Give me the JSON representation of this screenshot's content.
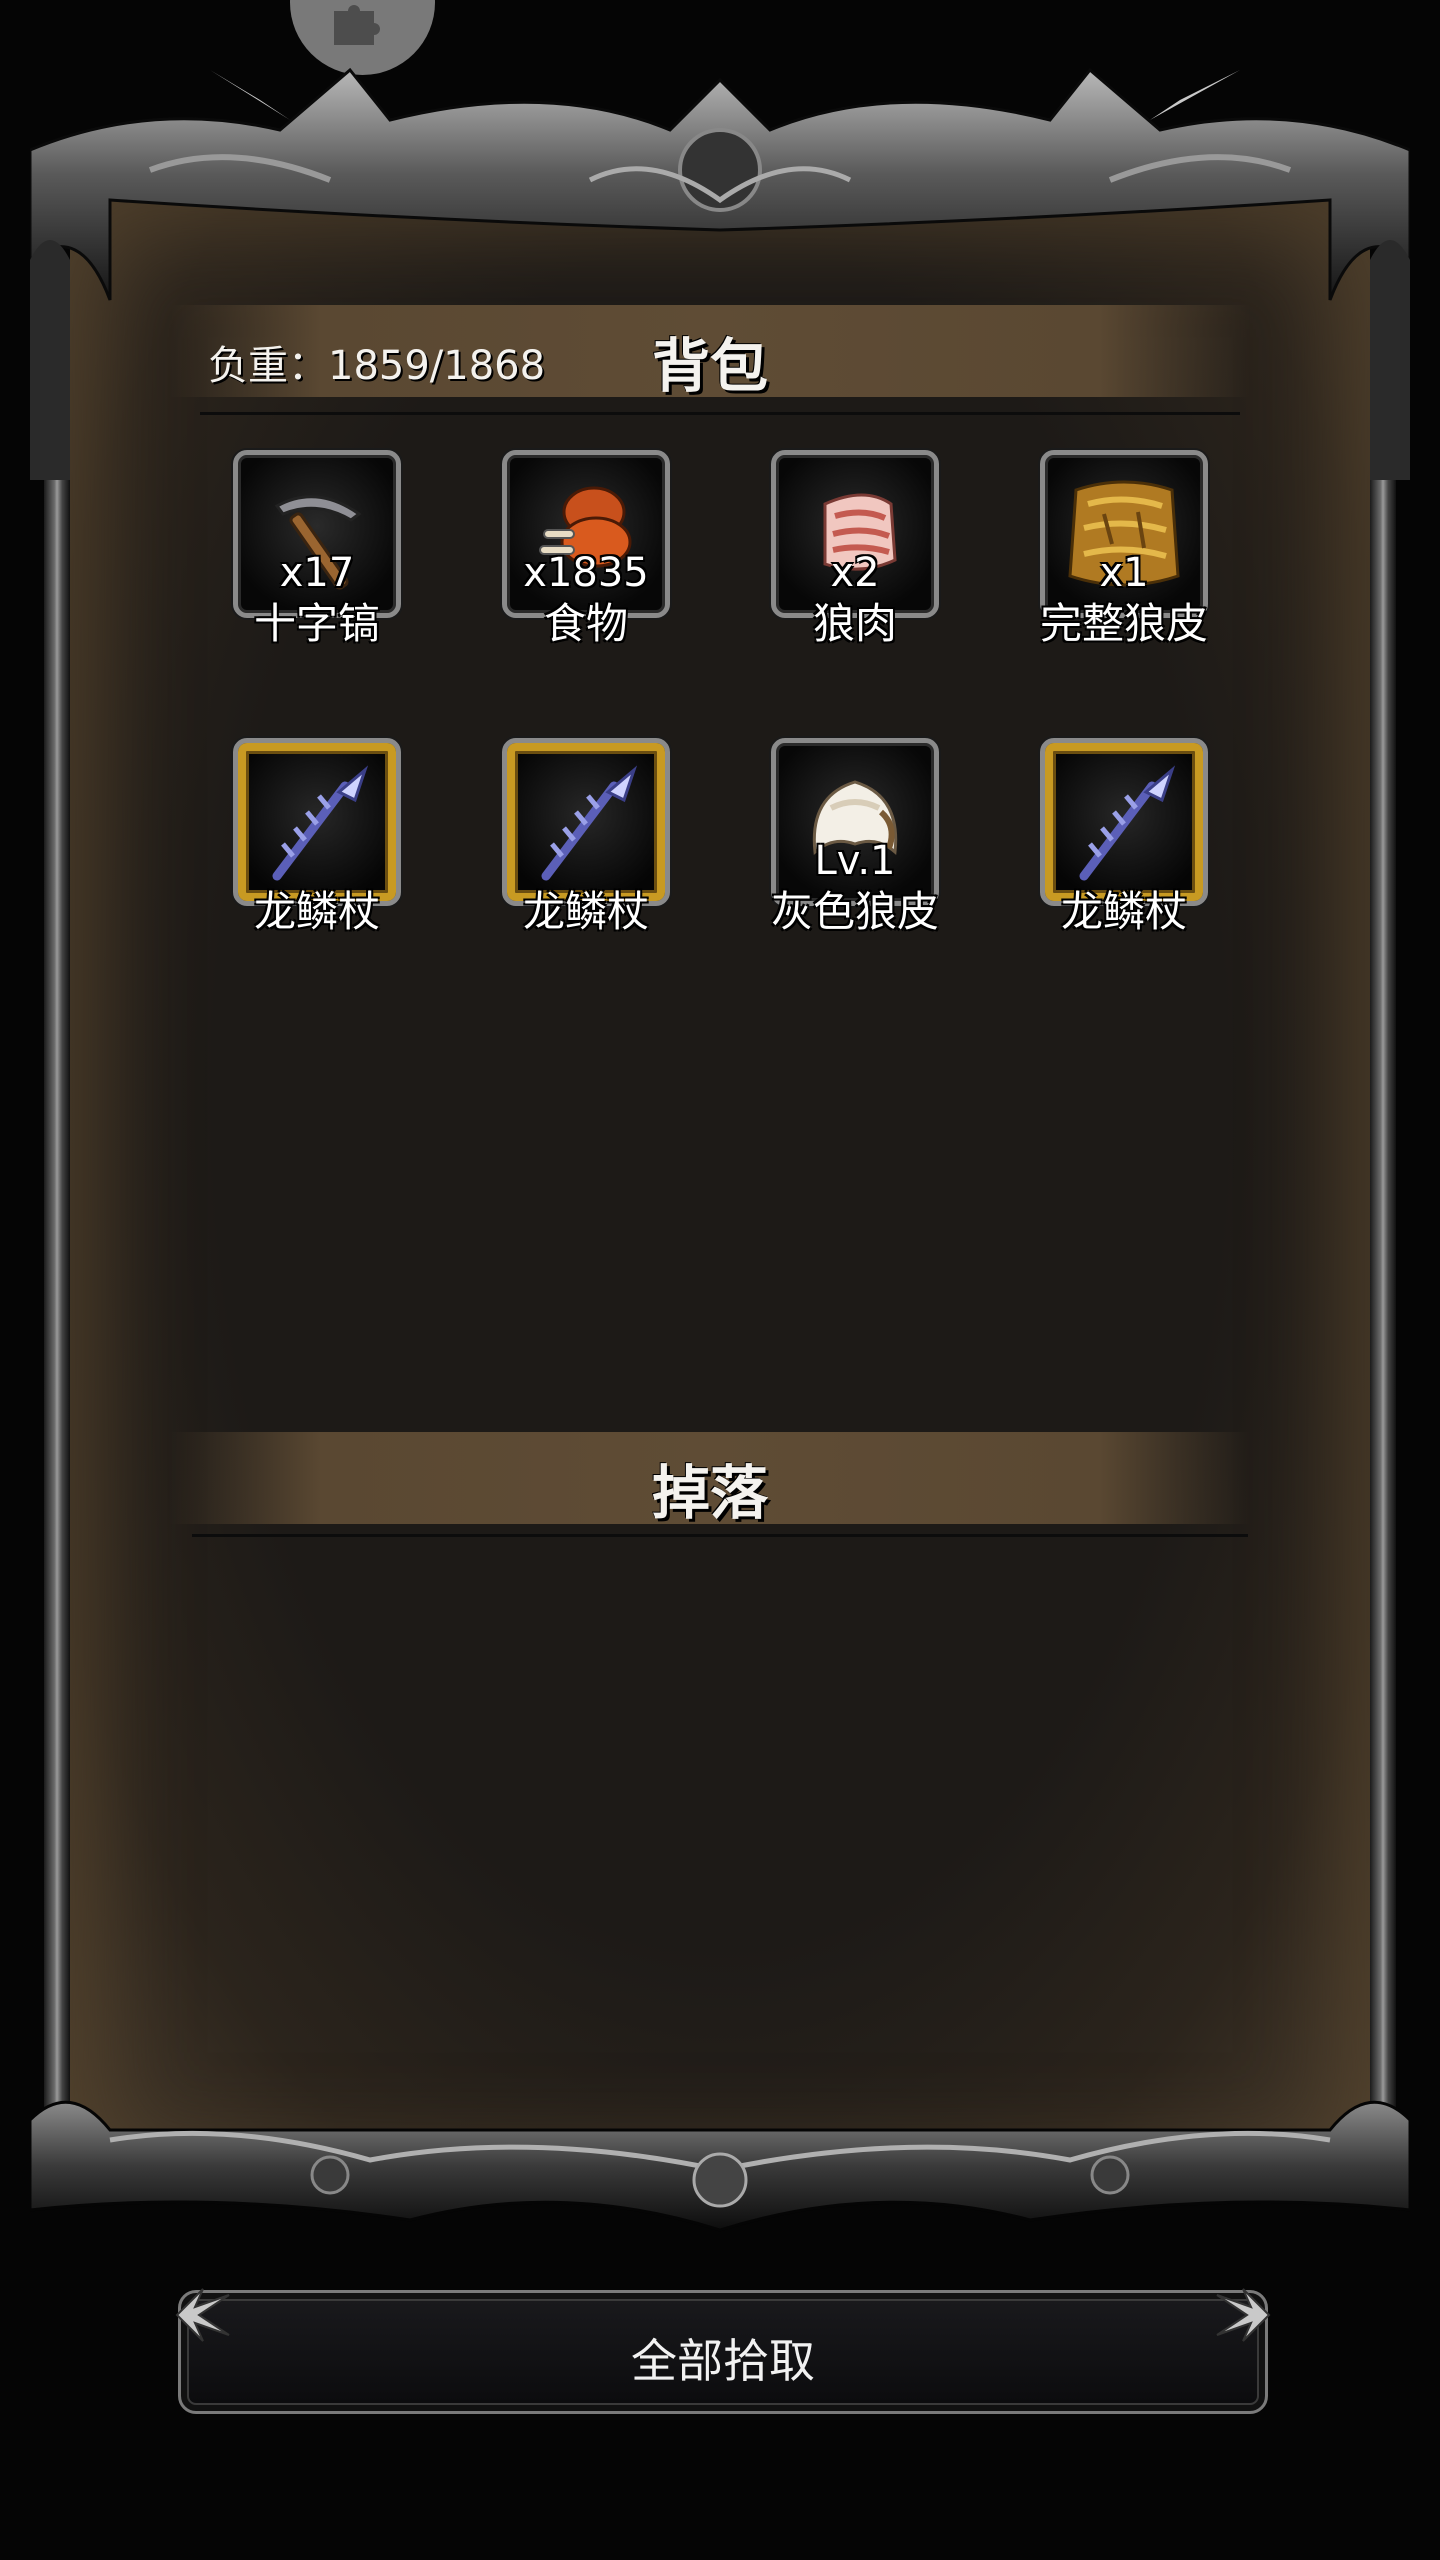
{
  "window": {
    "floating_tool_icon": "puzzle-icon"
  },
  "bag": {
    "title": "背包",
    "weight_label": "负重：1859/1868",
    "items": [
      {
        "name": "十字镐",
        "count": "x17",
        "icon": "pickaxe-icon",
        "frame": "silver"
      },
      {
        "name": "食物",
        "count": "x1835",
        "icon": "drumstick-icon",
        "frame": "silver"
      },
      {
        "name": "狼肉",
        "count": "x2",
        "icon": "raw-meat-icon",
        "frame": "silver"
      },
      {
        "name": "完整狼皮",
        "count": "x1",
        "icon": "wolf-pelt-icon",
        "frame": "silver"
      },
      {
        "name": "龙鳞杖",
        "count": "",
        "icon": "dragon-staff-icon",
        "frame": "gold"
      },
      {
        "name": "龙鳞杖",
        "count": "",
        "icon": "dragon-staff-icon",
        "frame": "gold"
      },
      {
        "name": "灰色狼皮",
        "count": "Lv.1",
        "icon": "gray-fur-icon",
        "frame": "silver"
      },
      {
        "name": "龙鳞杖",
        "count": "",
        "icon": "dragon-staff-icon",
        "frame": "gold"
      }
    ]
  },
  "drops": {
    "title": "掉落",
    "items": []
  },
  "actions": {
    "pickup_all_label": "全部拾取"
  },
  "colors": {
    "header_band": "#5f4c35",
    "gold_frame": "#c89a22",
    "silver_frame": "#8a8a8a",
    "text": "#f4f2ee"
  }
}
